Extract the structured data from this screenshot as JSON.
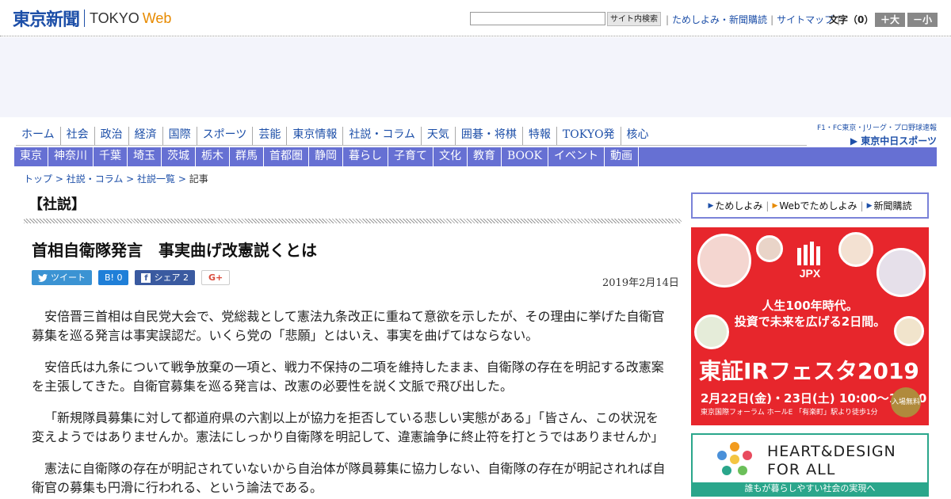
{
  "header": {
    "logo_jp": "東京新聞",
    "logo_en": "TOKYO",
    "logo_web": "Web",
    "search_button": "サイト内検索",
    "links": [
      "ためしよみ・新聞購読",
      "サイトマップ"
    ],
    "font_label": "文字（0）",
    "font_bigger": "＋大",
    "font_smaller": "－小"
  },
  "nav1": [
    "ホーム",
    "社会",
    "政治",
    "経済",
    "国際",
    "スポーツ",
    "芸能",
    "東京情報",
    "社説・コラム",
    "天気",
    "囲碁・将棋",
    "特報",
    "TOKYO発",
    "核心"
  ],
  "chunichi": {
    "top": "F1・FC東京・Jリーグ・プロ野球速報",
    "bottom": "▶ 東京中日スポーツ"
  },
  "nav2": [
    "東京",
    "神奈川",
    "千葉",
    "埼玉",
    "茨城",
    "栃木",
    "群馬",
    "首都圏",
    "静岡",
    "暮らし",
    "子育て",
    "文化",
    "教育",
    "BOOK",
    "イベント",
    "動画"
  ],
  "breadcrumb": {
    "items": [
      "トップ",
      "社説・コラム",
      "社説一覧"
    ],
    "current": "記事"
  },
  "article": {
    "section": "【社説】",
    "title": "首相自衛隊発言　事実曲げ改憲説くとは",
    "date": "2019年2月14日",
    "share": {
      "tweet": "ツイート",
      "hatena": "B! 0",
      "facebook": "シェア 2",
      "gplus": "G+"
    },
    "paragraphs": [
      "安倍晋三首相は自民党大会で、党総裁として憲法九条改正に重ねて意欲を示したが、その理由に挙げた自衛官募集を巡る発言は事実誤認だ。いくら党の「悲願」とはいえ、事実を曲げてはならない。",
      "安倍氏は九条について戦争放棄の一項と、戦力不保持の二項を維持したまま、自衛隊の存在を明記する改憲案を主張してきた。自衛官募集を巡る発言は、改憲の必要性を説く文脈で飛び出した。",
      "「新規隊員募集に対して都道府県の六割以上が協力を拒否している悲しい実態がある」「皆さん、この状況を変えようではありませんか。憲法にしっかり自衛隊を明記して、違憲論争に終止符を打とうではありませんか」",
      "憲法に自衛隊の存在が明記されていないから自治体が隊員募集に協力しない、自衛隊の存在が明記されれば自衛官の募集も円滑に行われる、という論法である。"
    ]
  },
  "right": {
    "box_links": [
      "ためしよみ",
      "Webでためしよみ",
      "新聞購読"
    ],
    "jpx_ad": {
      "brand": "JPX",
      "line1": "人生100年時代。",
      "line2": "投資で未来を広げる2日間。",
      "fest": "東証IRフェスタ2019",
      "when": "2月22日(金)・23日(土) 10:00～18:00",
      "where": "東京国際フォーラム ホールE 「有楽町」駅より徒歩1分",
      "free": "入場無料"
    },
    "heart_ad": {
      "line1": "HEART&DESIGN",
      "line2": "FOR ALL",
      "bar": "誰もが暮らしやすい社会の実現へ"
    }
  }
}
